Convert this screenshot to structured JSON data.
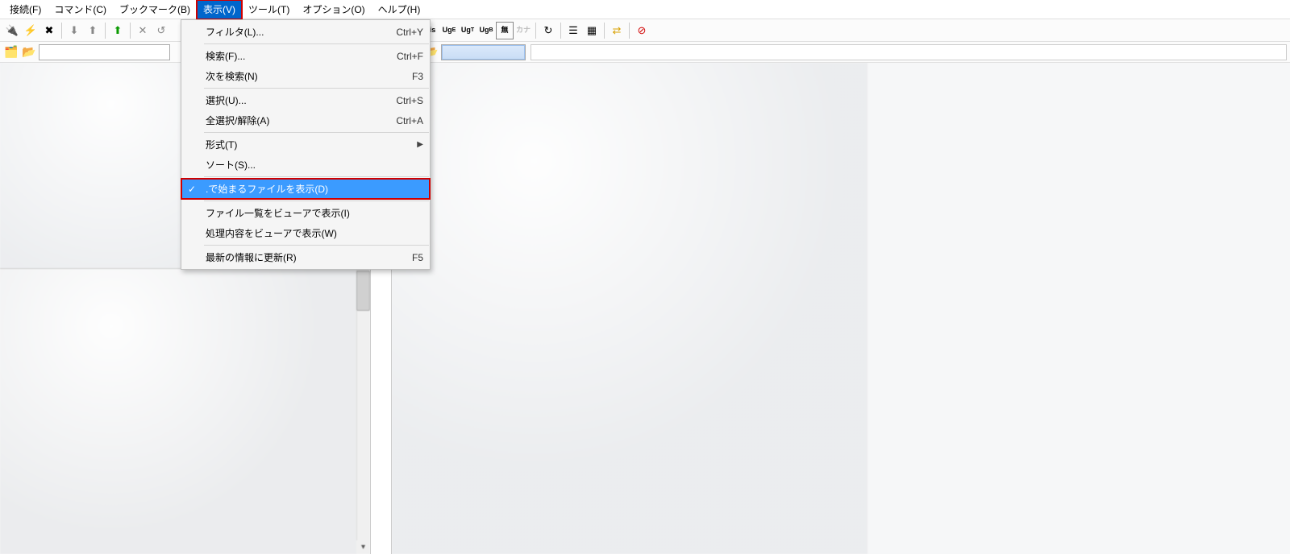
{
  "menubar": {
    "connect": "接続(F)",
    "command": "コマンド(C)",
    "bookmark": "ブックマーク(B)",
    "view": "表示(V)",
    "tool": "ツール(T)",
    "option": "オプション(O)",
    "help": "ヘルプ(H)"
  },
  "toolbar": {
    "jis": "Jis",
    "uge": "Ug",
    "ugt": "Ug",
    "ugb": "Ug",
    "none": "無",
    "kana": "カナ"
  },
  "dropdown": {
    "filter": {
      "label": "フィルタ(L)...",
      "shortcut": "Ctrl+Y"
    },
    "search": {
      "label": "検索(F)...",
      "shortcut": "Ctrl+F"
    },
    "findnext": {
      "label": "次を検索(N)",
      "shortcut": "F3"
    },
    "select": {
      "label": "選択(U)...",
      "shortcut": "Ctrl+S"
    },
    "selectall": {
      "label": "全選択/解除(A)",
      "shortcut": "Ctrl+A"
    },
    "format": {
      "label": "形式(T)"
    },
    "sort": {
      "label": "ソート(S)..."
    },
    "dotfiles": {
      "label": ".で始まるファイルを表示(D)"
    },
    "listviewer": {
      "label": "ファイル一覧をビューアで表示(I)"
    },
    "logviewer": {
      "label": "処理内容をビューアで表示(W)"
    },
    "refresh": {
      "label": "最新の情報に更新(R)",
      "shortcut": "F5"
    }
  }
}
